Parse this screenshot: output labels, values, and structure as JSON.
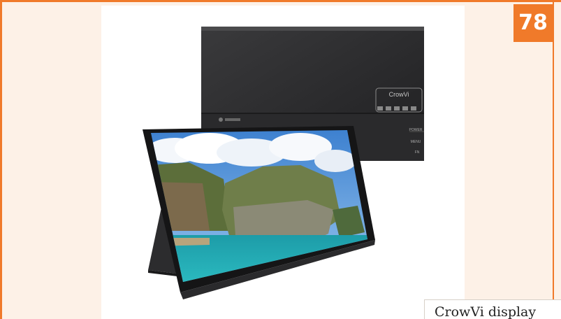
{
  "page": {
    "number": "78",
    "accent_color": "#f07a2a",
    "background_color": "#fdf1e7"
  },
  "caption": {
    "text": "CrowVi display"
  },
  "product": {
    "brand_label": "CrowVi",
    "rear_button_labels": [
      "POWER",
      "MENU",
      "FN"
    ],
    "screen_scene_icon": "coastal-cliff-landscape",
    "rear_logo_icon": "brand-logo-icon",
    "certification_marks_icon": "certification-marks-icon"
  }
}
